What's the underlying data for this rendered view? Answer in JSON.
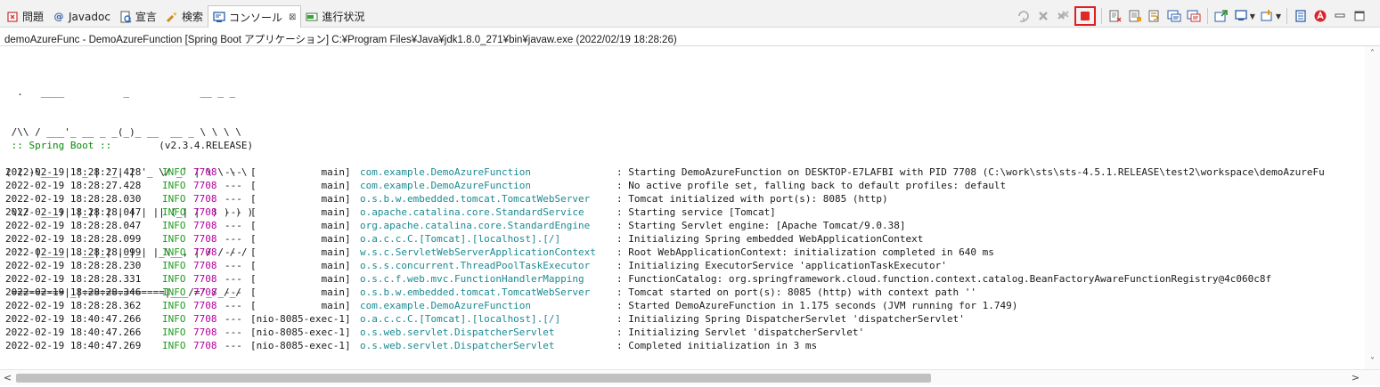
{
  "tabs": [
    {
      "label": "問題",
      "icon": "problems-icon"
    },
    {
      "label": "Javadoc",
      "icon": "javadoc-at-icon"
    },
    {
      "label": "宣言",
      "icon": "declaration-icon"
    },
    {
      "label": "検索",
      "icon": "search-flashlight-icon"
    },
    {
      "label": "コンソール",
      "icon": "console-icon",
      "active": true,
      "close": "⊠"
    },
    {
      "label": "進行状況",
      "icon": "progress-icon"
    }
  ],
  "tab_glyphs": {
    "javadoc": "@"
  },
  "process_line": "demoAzureFunc - DemoAzureFunction [Spring Boot アプリケーション] C:¥Program Files¥Java¥jdk1.8.0_271¥bin¥javaw.exe  (2022/02/19 18:28:26)",
  "banner": {
    "lines": [
      "  .   ____          _            __ _ _",
      " /\\\\ / ___'_ __ _ _(_)_ __  __ _ \\ \\ \\ \\",
      "( ( )\\___ | '_ | '_| | '_ \\/ _` | \\ \\ \\ \\",
      " \\\\/  ___)| |_)| | | | | || (_| |  ) ) ) )",
      "  '  |____| .__|_| |_|_| |_\\__, | / / / /",
      " =========|_|==============|___/=/_/_/_/"
    ],
    "spring_label": " :: Spring Boot :: ",
    "version": "       (v2.3.4.RELEASE)"
  },
  "log_rows": [
    {
      "ts": "2022-02-19 18:28:27.428",
      "level": "INFO",
      "pid": "7708",
      "sep": "---",
      "thread": "[           main]",
      "logger": "com.example.DemoAzureFunction",
      "msg": ": Starting DemoAzureFunction on DESKTOP-E7LAFBI with PID 7708 (C:\\work\\sts\\sts-4.5.1.RELEASE\\test2\\workspace\\demoAzureFu"
    },
    {
      "ts": "2022-02-19 18:28:27.428",
      "level": "INFO",
      "pid": "7708",
      "sep": "---",
      "thread": "[           main]",
      "logger": "com.example.DemoAzureFunction",
      "msg": ": No active profile set, falling back to default profiles: default"
    },
    {
      "ts": "2022-02-19 18:28:28.030",
      "level": "INFO",
      "pid": "7708",
      "sep": "---",
      "thread": "[           main]",
      "logger": "o.s.b.w.embedded.tomcat.TomcatWebServer",
      "msg": ": Tomcat initialized with port(s): 8085 (http)"
    },
    {
      "ts": "2022-02-19 18:28:28.047",
      "level": "INFO",
      "pid": "7708",
      "sep": "---",
      "thread": "[           main]",
      "logger": "o.apache.catalina.core.StandardService",
      "msg": ": Starting service [Tomcat]"
    },
    {
      "ts": "2022-02-19 18:28:28.047",
      "level": "INFO",
      "pid": "7708",
      "sep": "---",
      "thread": "[           main]",
      "logger": "org.apache.catalina.core.StandardEngine",
      "msg": ": Starting Servlet engine: [Apache Tomcat/9.0.38]"
    },
    {
      "ts": "2022-02-19 18:28:28.099",
      "level": "INFO",
      "pid": "7708",
      "sep": "---",
      "thread": "[           main]",
      "logger": "o.a.c.c.C.[Tomcat].[localhost].[/]",
      "msg": ": Initializing Spring embedded WebApplicationContext"
    },
    {
      "ts": "2022-02-19 18:28:28.099",
      "level": "INFO",
      "pid": "7708",
      "sep": "---",
      "thread": "[           main]",
      "logger": "w.s.c.ServletWebServerApplicationContext",
      "msg": ": Root WebApplicationContext: initialization completed in 640 ms"
    },
    {
      "ts": "2022-02-19 18:28:28.230",
      "level": "INFO",
      "pid": "7708",
      "sep": "---",
      "thread": "[           main]",
      "logger": "o.s.s.concurrent.ThreadPoolTaskExecutor",
      "msg": ": Initializing ExecutorService 'applicationTaskExecutor'"
    },
    {
      "ts": "2022-02-19 18:28:28.331",
      "level": "INFO",
      "pid": "7708",
      "sep": "---",
      "thread": "[           main]",
      "logger": "o.s.c.f.web.mvc.FunctionHandlerMapping",
      "msg": ": FunctionCatalog: org.springframework.cloud.function.context.catalog.BeanFactoryAwareFunctionRegistry@4c060c8f"
    },
    {
      "ts": "2022-02-19 18:28:28.346",
      "level": "INFO",
      "pid": "7708",
      "sep": "---",
      "thread": "[           main]",
      "logger": "o.s.b.w.embedded.tomcat.TomcatWebServer",
      "msg": ": Tomcat started on port(s): 8085 (http) with context path ''"
    },
    {
      "ts": "2022-02-19 18:28:28.362",
      "level": "INFO",
      "pid": "7708",
      "sep": "---",
      "thread": "[           main]",
      "logger": "com.example.DemoAzureFunction",
      "msg": ": Started DemoAzureFunction in 1.175 seconds (JVM running for 1.749)"
    },
    {
      "ts": "2022-02-19 18:40:47.266",
      "level": "INFO",
      "pid": "7708",
      "sep": "---",
      "thread": "[nio-8085-exec-1]",
      "logger": "o.a.c.c.C.[Tomcat].[localhost].[/]",
      "msg": ": Initializing Spring DispatcherServlet 'dispatcherServlet'"
    },
    {
      "ts": "2022-02-19 18:40:47.266",
      "level": "INFO",
      "pid": "7708",
      "sep": "---",
      "thread": "[nio-8085-exec-1]",
      "logger": "o.s.web.servlet.DispatcherServlet",
      "msg": ": Initializing Servlet 'dispatcherServlet'"
    },
    {
      "ts": "2022-02-19 18:40:47.269",
      "level": "INFO",
      "pid": "7708",
      "sep": "---",
      "thread": "[nio-8085-exec-1]",
      "logger": "o.s.web.servlet.DispatcherServlet",
      "msg": ": Completed initialization in 3 ms"
    }
  ],
  "scroll": {
    "up": "˄",
    "down": "˅",
    "left": "<",
    "right": ">"
  },
  "colors": {
    "level_info": "#1f9b1f",
    "pid": "#b4009e",
    "logger": "#1c8a91",
    "stop_highlight": "#e02020"
  },
  "toolbar_icons": [
    "remove-launch-icon",
    "terminate-icon",
    "remove-all-terminated-icon",
    "terminate-highlighted-icon",
    "clear-console-icon",
    "scroll-lock-icon",
    "word-wrap-icon",
    "show-on-stdout-icon",
    "show-on-stderr-icon",
    "pin-console-icon",
    "display-selected-console-icon",
    "open-console-icon",
    "view-menu-icon",
    "minimize-icon",
    "maximize-icon"
  ]
}
